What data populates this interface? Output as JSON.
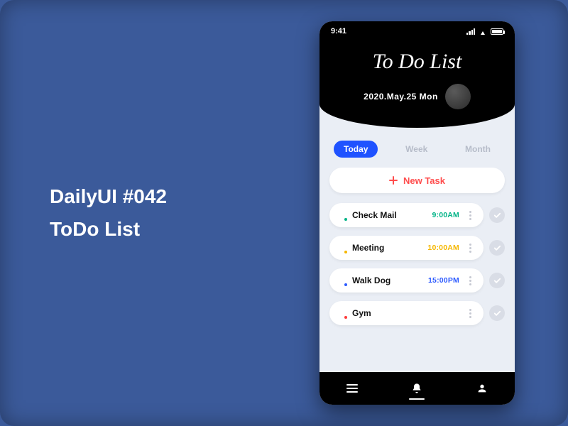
{
  "left_panel": {
    "line1": "DailyUI  #042",
    "line2": "ToDo List"
  },
  "statusbar": {
    "time": "9:41"
  },
  "header": {
    "title": "To Do List",
    "date": "2020.May.25  Mon"
  },
  "tabs": {
    "today": "Today",
    "week": "Week",
    "month": "Month"
  },
  "new_task_label": "New Task",
  "tasks": [
    {
      "name": "Check Mail",
      "time": "9:00AM",
      "dot": "#00b386",
      "time_color": "#00b386"
    },
    {
      "name": "Meeting",
      "time": "10:00AM",
      "dot": "#f5b700",
      "time_color": "#f5b700"
    },
    {
      "name": "Walk Dog",
      "time": "15:00PM",
      "dot": "#2d5bff",
      "time_color": "#2d5bff"
    },
    {
      "name": "Gym",
      "time": "",
      "dot": "#ff3b3b",
      "time_color": "#ff3b3b"
    }
  ],
  "colors": {
    "bg": "#3b5a9a",
    "phone_body": "#eaeef5",
    "accent": "#1f52ff",
    "danger": "#ff4d4d"
  }
}
